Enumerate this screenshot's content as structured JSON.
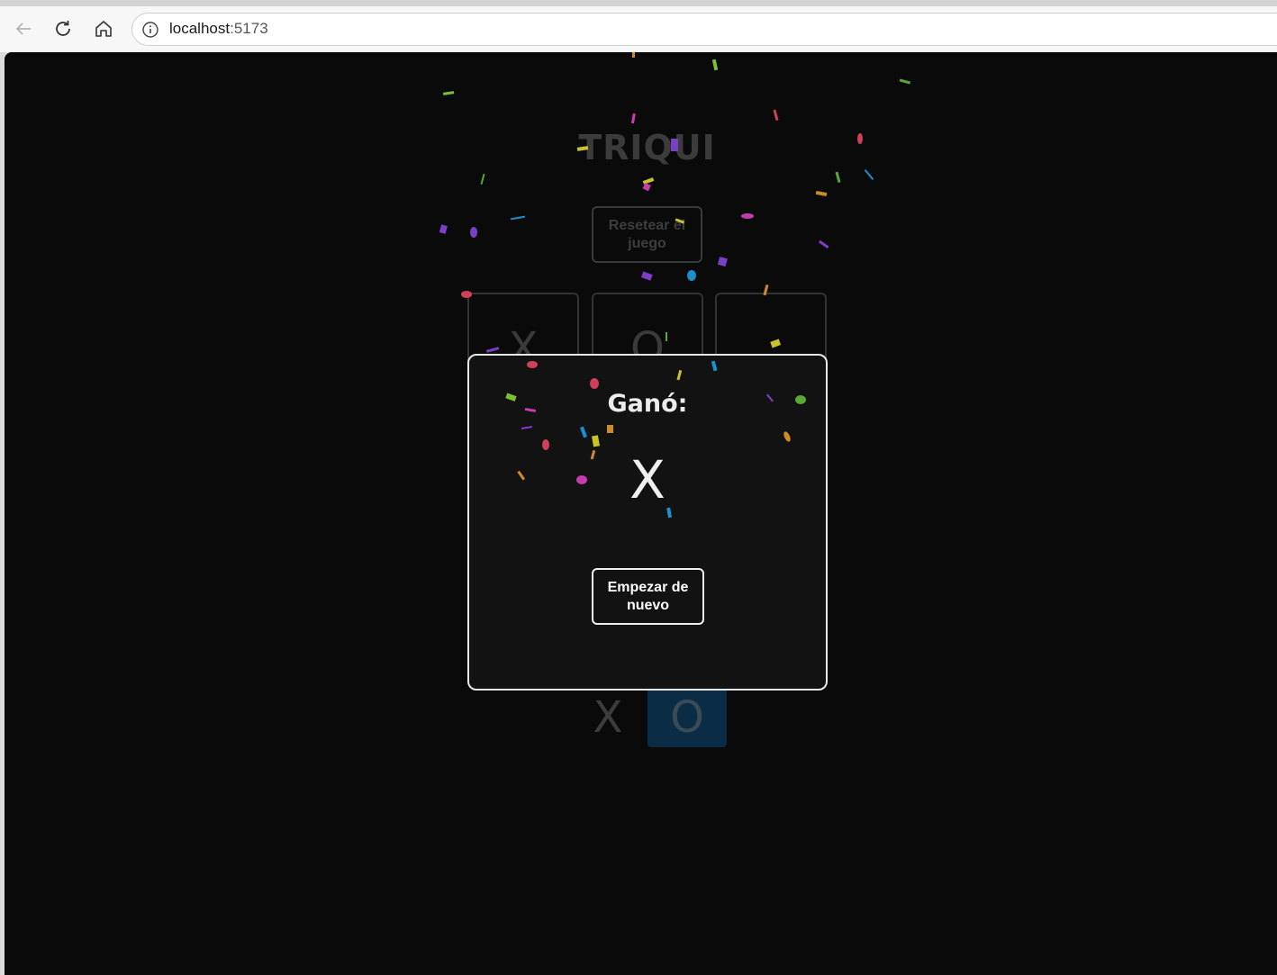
{
  "browser": {
    "url_host": "localhost",
    "url_port": ":5173"
  },
  "game": {
    "title": "TRIQUI",
    "reset_label": "Resetear el juego",
    "board": [
      "X",
      "O",
      "",
      "",
      "",
      "",
      "",
      "",
      ""
    ],
    "turn_x": "X",
    "turn_o": "O",
    "active_turn": "O"
  },
  "modal": {
    "title": "Ganó:",
    "winner": "X",
    "restart_label": "Empezar de nuevo"
  },
  "colors": {
    "background": "#0a0a0a",
    "modal_border": "#e8e8e8",
    "active_turn_bg": "#0b2c45"
  }
}
